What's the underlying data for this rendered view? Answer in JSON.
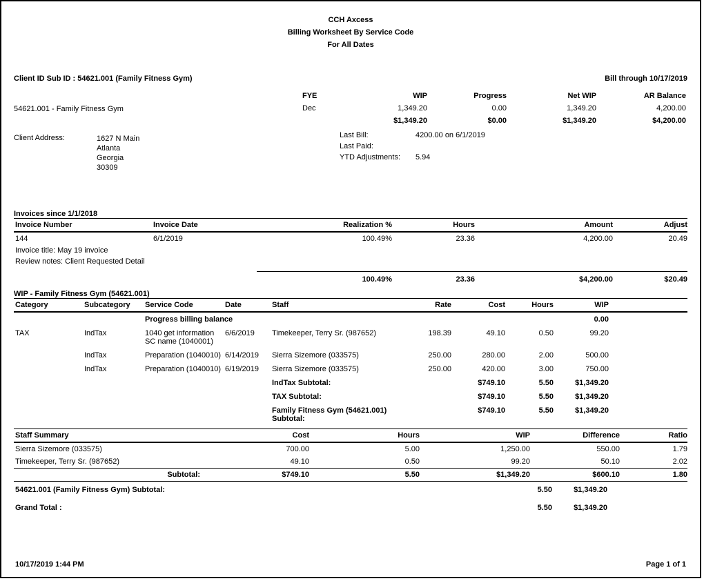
{
  "header": {
    "line1": "CCH Axcess",
    "line2": "Billing Worksheet By Service Code",
    "line3": "For All Dates"
  },
  "client": {
    "id_label": "Client ID Sub ID : 54621.001 (Family Fitness Gym)",
    "bill_through": "Bill through 10/17/2019",
    "row_label": "54621.001 - Family Fitness Gym",
    "cols": {
      "fye": "FYE",
      "wip": "WIP",
      "progress": "Progress",
      "netwip": "Net WIP",
      "ar": "AR Balance"
    },
    "vals": {
      "fye": "Dec",
      "wip": "1,349.20",
      "progress": "0.00",
      "netwip": "1,349.20",
      "ar": "4,200.00"
    },
    "totals": {
      "wip": "$1,349.20",
      "progress": "$0.00",
      "netwip": "$1,349.20",
      "ar": "$4,200.00"
    },
    "last_bill_label": "Last Bill:",
    "last_bill": "4200.00 on 6/1/2019",
    "last_paid_label": "Last Paid:",
    "last_paid": "",
    "ytd_label": "YTD Adjustments:",
    "ytd": "5.94",
    "addr_label": "Client Address:",
    "addr1": "1627 N Main",
    "addr2": "Atlanta",
    "addr3": "Georgia",
    "addr4": "30309"
  },
  "invoices": {
    "title": "Invoices since 1/1/2018",
    "cols": {
      "num": "Invoice Number",
      "date": "Invoice Date",
      "real": "Realization %",
      "hours": "Hours",
      "amount": "Amount",
      "adjust": "Adjust"
    },
    "row": {
      "num": "144",
      "date": "6/1/2019",
      "real": "100.49%",
      "hours": "23.36",
      "amount": "4,200.00",
      "adjust": "20.49"
    },
    "note1": "Invoice title: May 19 invoice",
    "note2": "Review notes: Client Requested Detail",
    "totals": {
      "real": "100.49%",
      "hours": "23.36",
      "amount": "$4,200.00",
      "adjust": "$20.49"
    }
  },
  "wip": {
    "title": "WIP - Family Fitness Gym (54621.001)",
    "cols": {
      "cat": "Category",
      "sub": "Subcategory",
      "svc": "Service Code",
      "date": "Date",
      "staff": "Staff",
      "rate": "Rate",
      "cost": "Cost",
      "hours": "Hours",
      "wip": "WIP"
    },
    "progress_label": "Progress billing balance",
    "progress_val": "0.00",
    "r1": {
      "cat": "TAX",
      "sub": "IndTax",
      "svc": "1040 get information SC name (1040001)",
      "date": "6/6/2019",
      "staff": "Timekeeper, Terry Sr. (987652)",
      "rate": "198.39",
      "cost": "49.10",
      "hours": "0.50",
      "wip": "99.20"
    },
    "r2": {
      "cat": "",
      "sub": "IndTax",
      "svc": "Preparation (1040010)",
      "date": "6/14/2019",
      "staff": "Sierra Sizemore (033575)",
      "rate": "250.00",
      "cost": "280.00",
      "hours": "2.00",
      "wip": "500.00"
    },
    "r3": {
      "cat": "",
      "sub": "IndTax",
      "svc": "Preparation (1040010)",
      "date": "6/19/2019",
      "staff": "Sierra Sizemore (033575)",
      "rate": "250.00",
      "cost": "420.00",
      "hours": "3.00",
      "wip": "750.00"
    },
    "s1": {
      "label": "IndTax Subtotal:",
      "cost": "$749.10",
      "hours": "5.50",
      "wip": "$1,349.20"
    },
    "s2": {
      "label": "TAX Subtotal:",
      "cost": "$749.10",
      "hours": "5.50",
      "wip": "$1,349.20"
    },
    "s3": {
      "label": "Family Fitness Gym (54621.001) Subtotal:",
      "cost": "$749.10",
      "hours": "5.50",
      "wip": "$1,349.20"
    }
  },
  "staff": {
    "title": "Staff Summary",
    "cols": {
      "cost": "Cost",
      "hours": "Hours",
      "wip": "WIP",
      "diff": "Difference",
      "ratio": "Ratio"
    },
    "r1": {
      "name": "Sierra Sizemore (033575)",
      "cost": "700.00",
      "hours": "5.00",
      "wip": "1,250.00",
      "diff": "550.00",
      "ratio": "1.79"
    },
    "r2": {
      "name": "Timekeeper, Terry Sr. (987652)",
      "cost": "49.10",
      "hours": "0.50",
      "wip": "99.20",
      "diff": "50.10",
      "ratio": "2.02"
    },
    "sub": {
      "label": "Subtotal:",
      "cost": "$749.10",
      "hours": "5.50",
      "wip": "$1,349.20",
      "diff": "$600.10",
      "ratio": "1.80"
    }
  },
  "client_subtotal": {
    "label": "54621.001 (Family Fitness Gym) Subtotal:",
    "hours": "5.50",
    "wip": "$1,349.20"
  },
  "grand_total": {
    "label": "Grand Total :",
    "hours": "5.50",
    "wip": "$1,349.20"
  },
  "footer": {
    "ts": "10/17/2019 1:44 PM",
    "page": "Page 1 of 1"
  }
}
